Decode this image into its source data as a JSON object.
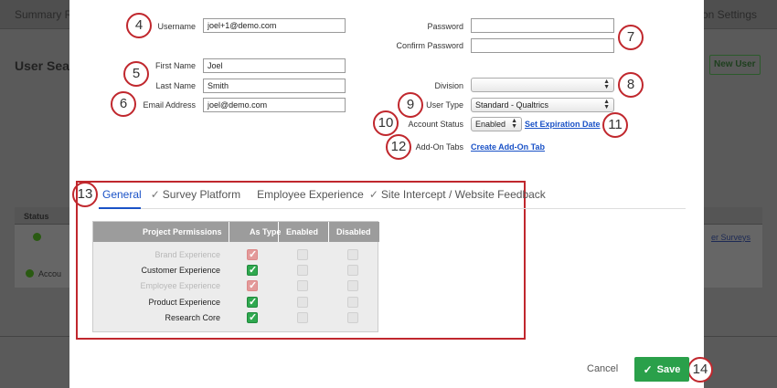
{
  "background": {
    "tab_left": "Summary R",
    "tab_right": "on Settings",
    "page_title": "User Sea",
    "new_user_label": "New User",
    "status_header": "Status",
    "account_text": "Accou",
    "surveys_link": "er Surveys"
  },
  "form": {
    "username_label": "Username",
    "username_value": "joel+1@demo.com",
    "first_name_label": "First Name",
    "first_name_value": "Joel",
    "last_name_label": "Last Name",
    "last_name_value": "Smith",
    "email_label": "Email Address",
    "email_value": "joel@demo.com",
    "password_label": "Password",
    "confirm_password_label": "Confirm Password",
    "division_label": "Division",
    "division_value": "",
    "user_type_label": "User Type",
    "user_type_value": "Standard - Qualtrics",
    "account_status_label": "Account Status",
    "account_status_value": "Enabled",
    "set_expiration_link": "Set Expiration Date",
    "addon_tabs_label": "Add-On Tabs",
    "create_addon_link": "Create Add-On Tab"
  },
  "callouts": [
    "4",
    "5",
    "6",
    "7",
    "8",
    "9",
    "10",
    "11",
    "12",
    "13",
    "14"
  ],
  "tabs": [
    {
      "label": "General",
      "active": true
    },
    {
      "label": "Survey Platform",
      "checked": true
    },
    {
      "label": "Employee Experience",
      "checked": false
    },
    {
      "label": "Site Intercept / Website Feedback",
      "checked": true
    }
  ],
  "permissions": {
    "headers": [
      "Project Permissions",
      "As Type",
      "Enabled",
      "Disabled"
    ],
    "rows": [
      {
        "name": "Brand Experience",
        "dim": true,
        "as_type": true
      },
      {
        "name": "Customer Experience",
        "dim": false,
        "as_type": true
      },
      {
        "name": "Employee Experience",
        "dim": true,
        "as_type": true
      },
      {
        "name": "Product Experience",
        "dim": false,
        "as_type": true
      },
      {
        "name": "Research Core",
        "dim": false,
        "as_type": true
      }
    ]
  },
  "footer": {
    "cancel_label": "Cancel",
    "save_label": "Save"
  },
  "colors": {
    "accent": "#1a52c7",
    "callout_border": "#c0272d",
    "save_green": "#2aa04a",
    "check_green": "#2fa84f"
  }
}
